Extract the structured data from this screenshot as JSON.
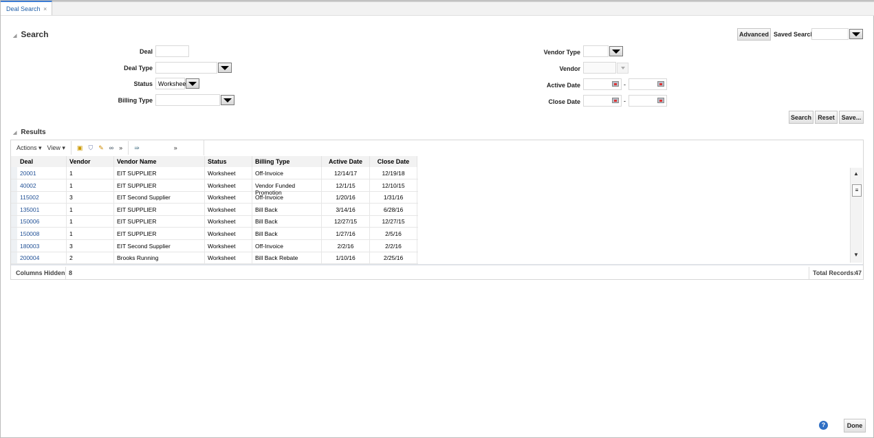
{
  "tab": {
    "label": "Deal Search",
    "close": "×"
  },
  "search": {
    "title": "Search",
    "advanced": "Advanced",
    "saved_search_label": "Saved Search",
    "deal_label": "Deal",
    "deal_type_label": "Deal Type",
    "status_label": "Status",
    "status_value": "Worksheet",
    "billing_type_label": "Billing Type",
    "vendor_type_label": "Vendor Type",
    "vendor_label": "Vendor",
    "active_date_label": "Active Date",
    "close_date_label": "Close Date",
    "dash": "-",
    "search_btn": "Search",
    "reset_btn": "Reset",
    "save_btn": "Save..."
  },
  "results": {
    "title": "Results",
    "actions": "Actions ▾",
    "view": "View ▾",
    "more": "»",
    "columns": [
      "Deal",
      "Vendor",
      "Vendor Name",
      "Status",
      "Billing Type",
      "Active Date",
      "Close Date"
    ],
    "rows": [
      [
        "20001",
        "1",
        "EIT SUPPLIER",
        "Worksheet",
        "Off-Invoice",
        "12/14/17",
        "12/19/18"
      ],
      [
        "40002",
        "1",
        "EIT SUPPLIER",
        "Worksheet",
        "Vendor Funded Promotion",
        "12/1/15",
        "12/10/15"
      ],
      [
        "115002",
        "3",
        "EIT Second Supplier",
        "Worksheet",
        "Off-Invoice",
        "1/20/16",
        "1/31/16"
      ],
      [
        "135001",
        "1",
        "EIT SUPPLIER",
        "Worksheet",
        "Bill Back",
        "3/14/16",
        "6/28/16"
      ],
      [
        "150006",
        "1",
        "EIT SUPPLIER",
        "Worksheet",
        "Bill Back",
        "12/27/15",
        "12/27/15"
      ],
      [
        "150008",
        "1",
        "EIT SUPPLIER",
        "Worksheet",
        "Bill Back",
        "1/27/16",
        "2/5/16"
      ],
      [
        "180003",
        "3",
        "EIT Second Supplier",
        "Worksheet",
        "Off-Invoice",
        "2/2/16",
        "2/2/16"
      ],
      [
        "200004",
        "2",
        "Brooks Running",
        "Worksheet",
        "Bill Back Rebate",
        "1/10/16",
        "2/25/16"
      ]
    ],
    "columns_hidden_label": "Columns Hidden",
    "columns_hidden": "8",
    "total_label": "Total Records:",
    "total": "47"
  },
  "footer": {
    "help": "?",
    "done": "Done"
  }
}
